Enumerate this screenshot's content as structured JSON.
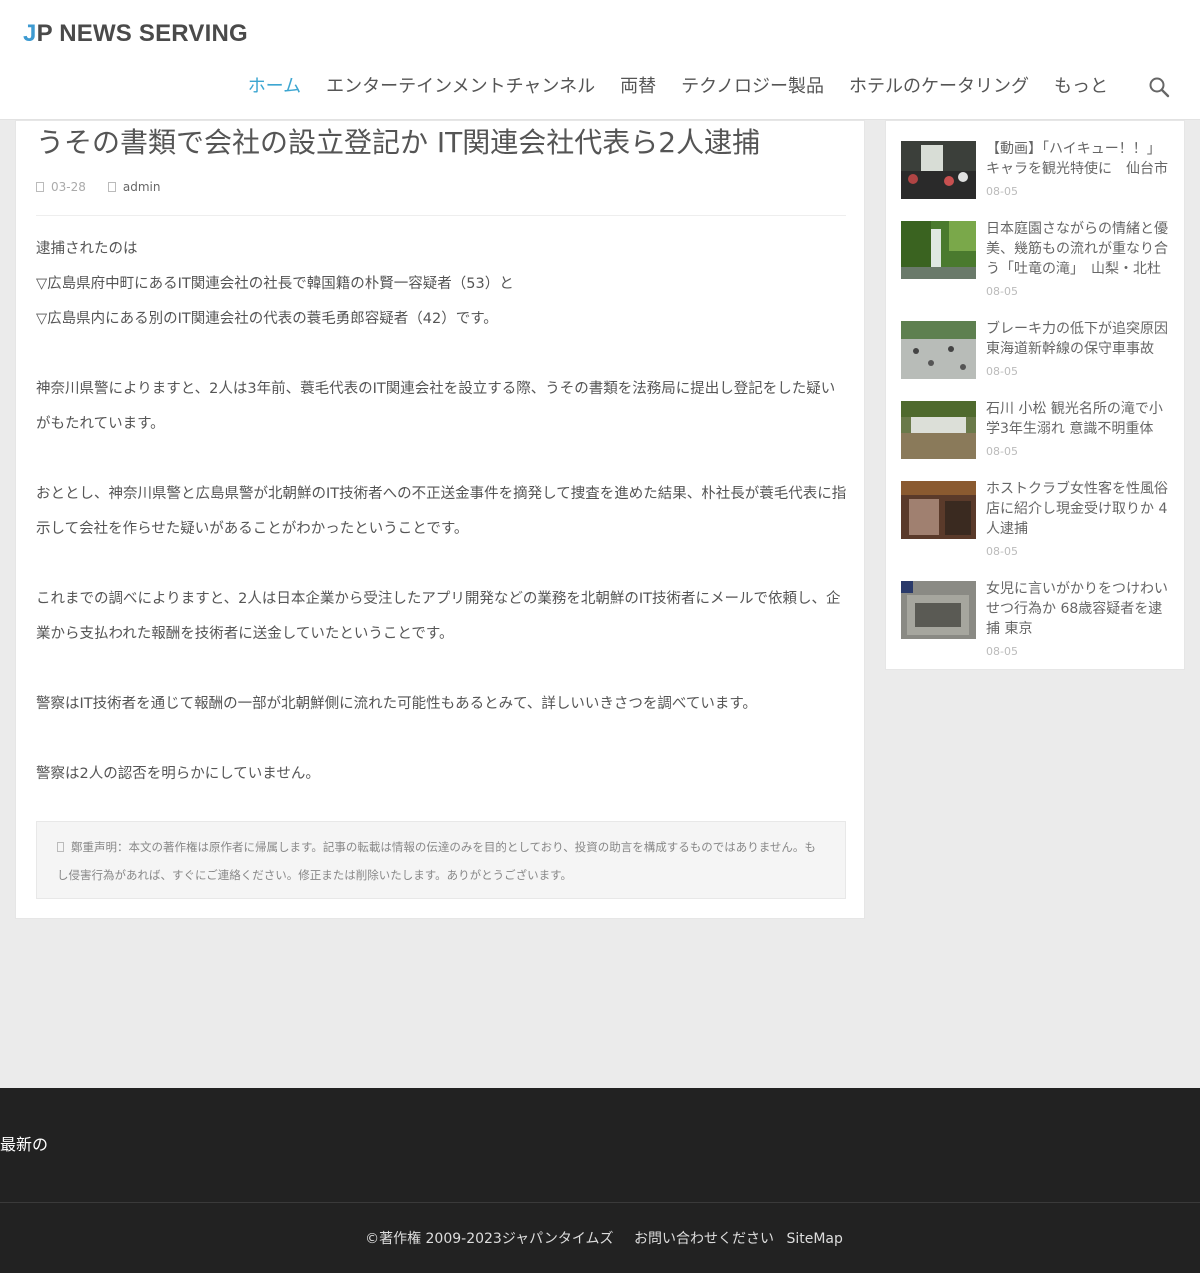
{
  "site": {
    "logo_first": "J",
    "logo_rest": "P NEWS SERVING"
  },
  "nav": {
    "items": [
      {
        "label": "ホーム",
        "active": true
      },
      {
        "label": "エンターテインメントチャンネル",
        "active": false
      },
      {
        "label": "両替",
        "active": false
      },
      {
        "label": "テクノロジー製品",
        "active": false
      },
      {
        "label": "ホテルのケータリング",
        "active": false
      },
      {
        "label": "もっと",
        "active": false
      }
    ],
    "search_icon": "search-icon"
  },
  "article": {
    "title": "うその書類で会社の設立登記か IT関連会社代表ら2人逮捕",
    "date": "03-28",
    "author": "admin",
    "paragraphs": [
      "逮捕されたのは",
      "▽広島県府中町にあるIT関連会社の社長で韓国籍の朴賢一容疑者（53）と",
      "▽広島県内にある別のIT関連会社の代表の蓑毛勇郎容疑者（42）です。",
      "",
      "神奈川県警によりますと、2人は3年前、蓑毛代表のIT関連会社を設立する際、うその書類を法務局に提出し登記をした疑いがもたれています。",
      "",
      "おととし、神奈川県警と広島県警が北朝鮮のIT技術者への不正送金事件を摘発して捜査を進めた結果、朴社長が蓑毛代表に指示して会社を作らせた疑いがあることがわかったということです。",
      "",
      "これまでの調べによりますと、2人は日本企業から受注したアプリ開発などの業務を北朝鮮のIT技術者にメールで依頼し、企業から支払われた報酬を技術者に送金していたということです。",
      "",
      "警察はIT技術者を通じて報酬の一部が北朝鮮側に流れた可能性もあるとみて、詳しいいきさつを調べています。",
      "",
      "警察は2人の認否を明らかにしていません。"
    ],
    "disclaimer": "鄭重声明：本文の著作権は原作者に帰属します。記事の転載は情報の伝達のみを目的としており、投資の助言を構成するものではありません。もし侵害行為があれば、すぐにご連絡ください。修正または削除いたします。ありがとうございます。"
  },
  "sidebar": {
    "items": [
      {
        "title": "【動画】「ハイキュー！！」キャラを観光特使に　仙台市",
        "date": "08-05"
      },
      {
        "title": "日本庭園さながらの情緒と優美、幾筋もの流れが重なり合う「吐竜の滝」　山梨・北杜",
        "date": "08-05"
      },
      {
        "title": "ブレーキ力の低下が追突原因 東海道新幹線の保守車事故",
        "date": "08-05"
      },
      {
        "title": "石川 小松 観光名所の滝で小学3年生溺れ 意識不明重体",
        "date": "08-05"
      },
      {
        "title": "ホストクラブ女性客を性風俗店に紹介し現金受け取りか 4人逮捕",
        "date": "08-05"
      },
      {
        "title": "女児に言いがかりをつけわいせつ行為か 68歳容疑者を逮捕 東京",
        "date": "08-05"
      }
    ]
  },
  "footer": {
    "heading": "最新の",
    "copyright": "©著作権 2009-2023ジャパンタイムズ",
    "contact": "お問い合わせください",
    "sitemap": "SiteMap"
  },
  "colors": {
    "accent": "#3da6d1",
    "footer_bg": "#222222",
    "page_bg": "#ebebeb"
  }
}
